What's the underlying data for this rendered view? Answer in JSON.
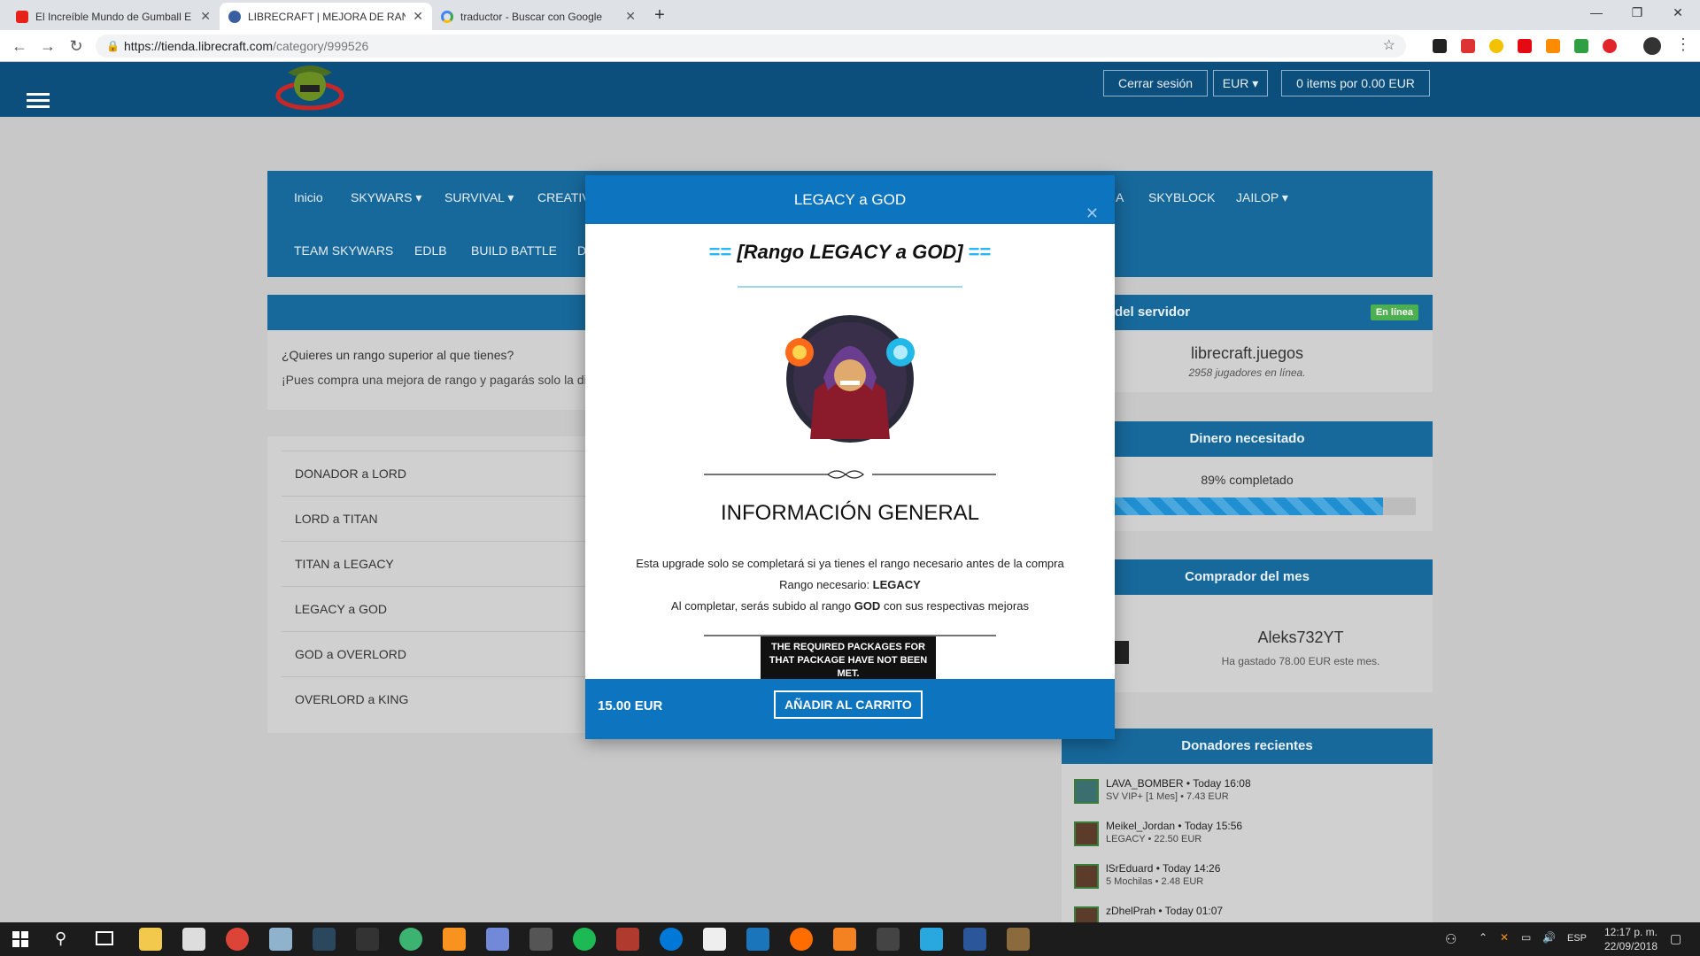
{
  "browser": {
    "tabs": [
      {
        "label": "El Increíble Mundo de Gumball E",
        "icon": "youtube-icon",
        "active": false
      },
      {
        "label": "LIBRECRAFT | MEJORA DE RANG",
        "icon": "librecraft-favicon",
        "active": true
      },
      {
        "label": "traductor - Buscar con Google",
        "icon": "google-icon",
        "active": false
      }
    ],
    "url_host": "https://tienda.librecraft.com",
    "url_path": "/category/999526"
  },
  "header": {
    "logout": "Cerrar sesión",
    "currency": "EUR",
    "cart": "0 items por 0.00 EUR"
  },
  "nav": {
    "row1": [
      "Inicio",
      "SKYWARS",
      "SURVIVAL",
      "CREATIV",
      "A",
      "SKYBLOCK",
      "JAILOP"
    ],
    "row2": [
      "TEAM SKYWARS",
      "EDLB",
      "BUILD BATTLE",
      "D"
    ]
  },
  "intro": {
    "question": "¿Quieres un rango superior al que tienes?",
    "text": "¡Pues compra una mejora de rango y pagarás solo la di"
  },
  "packages": [
    "DONADOR a LORD",
    "LORD a TITAN",
    "TITAN a LEGACY",
    "LEGACY a GOD",
    "GOD a OVERLORD",
    "OVERLORD a KING"
  ],
  "sidebar": {
    "status_title": "del servidor",
    "status_badge": "En línea",
    "server": "librecraft.juegos",
    "players": "2958 jugadores en línea.",
    "goal_title": "Dinero necesitado",
    "goal_text": "89% completado",
    "goal_progress": 89,
    "buyer_title": "Comprador del mes",
    "buyer_name": "Aleks732YT",
    "buyer_text": "Ha gastado 78.00 EUR este mes.",
    "donors_title": "Donadores recientes",
    "donors": [
      {
        "name": "LAVA_BOMBER • Today 16:08",
        "detail": "SV VIP+ [1 Mes] • 7.43 EUR"
      },
      {
        "name": "Meikel_Jordan • Today 15:56",
        "detail": "LEGACY • 22.50 EUR"
      },
      {
        "name": "lSrEduard • Today 14:26",
        "detail": "5 Mochilas • 2.48 EUR"
      },
      {
        "name": "zDhelPrah • Today 01:07",
        "detail": ""
      }
    ]
  },
  "modal": {
    "title": "LEGACY a GOD",
    "heading_left": "==",
    "heading": "[Rango LEGACY a GOD]",
    "heading_right": "==",
    "section_title": "INFORMACIÓN GENERAL",
    "line1": "Esta upgrade solo se completará si ya tienes el rango necesario antes de la compra",
    "line2_prefix": "Rango necesario: ",
    "line2_bold": "LEGACY",
    "line3_prefix": "Al completar, serás subido al rango ",
    "line3_bold": "GOD",
    "line3_suffix": " con sus respectivas mejoras",
    "tooltip": "THE REQUIRED PACKAGES FOR THAT PACKAGE HAVE NOT BEEN MET.",
    "price": "15.00 EUR",
    "button": "AÑADIR AL CARRITO"
  },
  "taskbar": {
    "lang": "ESP",
    "time": "12:17 p. m.",
    "date": "22/09/2018"
  },
  "colors": {
    "site_header": "#0d4f7c",
    "nav": "#17689b",
    "modal_head": "#0d74c0",
    "badge": "#4caf50",
    "progress": "#1f8fd1"
  }
}
